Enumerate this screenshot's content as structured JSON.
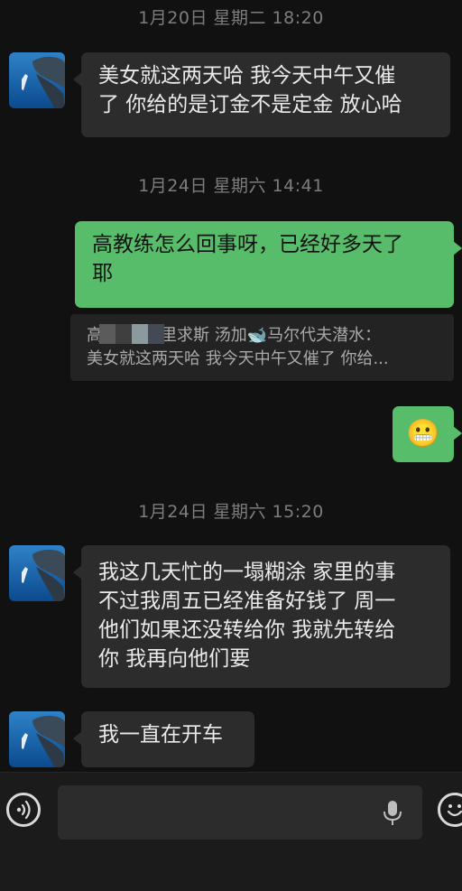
{
  "timestamps": [
    "1月20日 星期二 18:20",
    "1月24日 星期六 14:41",
    "1月24日 星期六 15:20"
  ],
  "messages": {
    "m1": [
      "美女就这两天哈 我今天中午又催",
      "了 你给的是订金不是定金 放心哈"
    ],
    "m2": [
      "高教练怎么回事呀，已经好多天了",
      "耶"
    ],
    "m3": [
      "我这几天忙的一塌糊涂 家里的事",
      "不过我周五已经准备好钱了 周一",
      "他们如果还没转给你 我就先转给",
      "你 我再向他们要"
    ],
    "m4": "我一直在开车"
  },
  "quote": {
    "line1_prefix": "高",
    "line1_suffix": "毛里求斯 汤加🐋马尔代夫潜水：",
    "line2": "美女就这两天哈 我今天中午又催了 你给..."
  },
  "sticker": "😬",
  "icons": {
    "avatar": "whale-diver-avatar",
    "voice": "voice-icon",
    "mic": "microphone-icon",
    "emoji": "emoji-icon"
  }
}
